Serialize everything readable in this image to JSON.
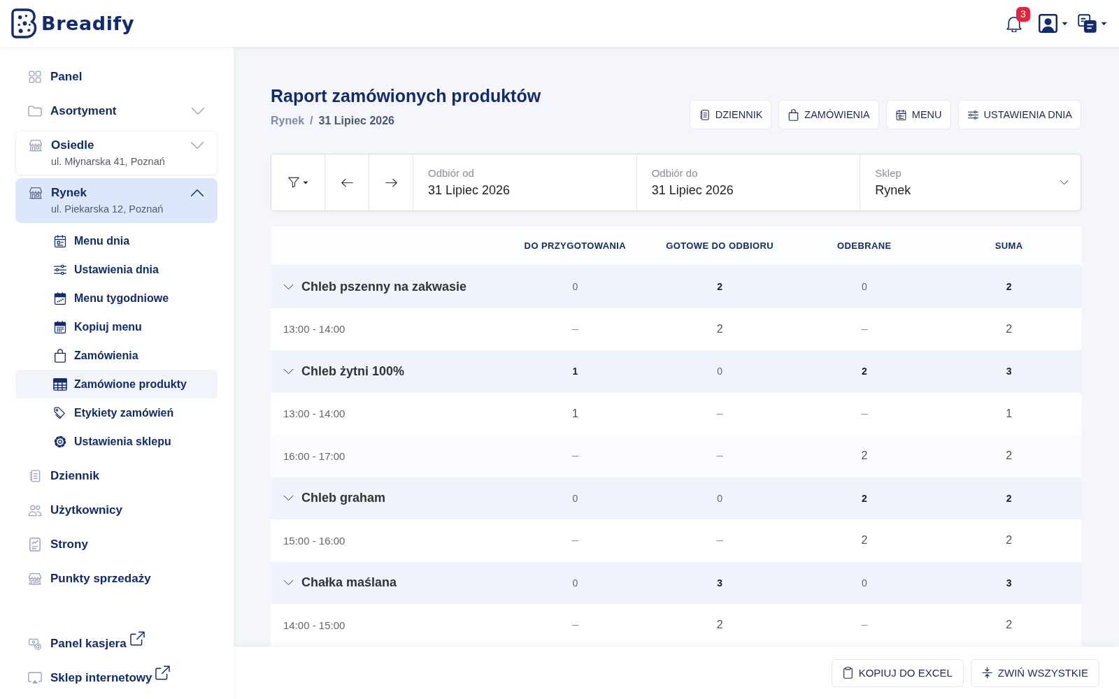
{
  "header": {
    "logo_text": "Breadify",
    "notifications": {
      "count": "3"
    }
  },
  "sidebar": {
    "items": [
      {
        "kind": "link",
        "label": "Panel",
        "selected": false
      },
      {
        "kind": "group",
        "label": "Asortyment",
        "expanded": false,
        "selected": false
      },
      {
        "kind": "store",
        "label": "Osiedle",
        "address": "ul. Młynarska 41, Poznań",
        "expanded": false,
        "selected": false
      },
      {
        "kind": "store",
        "label": "Rynek",
        "address": "ul. Piekarska 12, Poznań",
        "expanded": true,
        "selected": true,
        "children": [
          {
            "label": "Menu dnia",
            "selected": false
          },
          {
            "label": "Ustawienia dnia",
            "selected": false
          },
          {
            "label": "Menu tygodniowe",
            "selected": false
          },
          {
            "label": "Kopiuj menu",
            "selected": false
          },
          {
            "label": "Zamówienia",
            "selected": false
          },
          {
            "label": "Zamówione produkty",
            "selected": true
          },
          {
            "label": "Etykiety zamówień",
            "selected": false
          },
          {
            "label": "Ustawienia sklepu",
            "selected": false
          }
        ]
      },
      {
        "kind": "link",
        "label": "Dziennik",
        "selected": false
      },
      {
        "kind": "link",
        "label": "Użytkownicy",
        "selected": false
      },
      {
        "kind": "link",
        "label": "Strony",
        "selected": false
      },
      {
        "kind": "link",
        "label": "Punkty sprzedaży",
        "selected": false
      }
    ],
    "external_links": [
      {
        "label": "Panel kasjera"
      },
      {
        "label": "Sklep internetowy"
      }
    ]
  },
  "page": {
    "title": "Raport zamówionych produktów",
    "breadcrumb": {
      "items": [
        "Rynek",
        "31 Lipiec 2026"
      ],
      "separator": "/"
    },
    "actions": [
      "DZIENNIK",
      "ZAMÓWIENIA",
      "MENU",
      "USTAWIENIA DNIA"
    ]
  },
  "filters": {
    "fields": [
      {
        "kind": "date",
        "label": "Odbiór od",
        "value": "31 Lipiec 2026"
      },
      {
        "kind": "date",
        "label": "Odbiór do",
        "value": "31 Lipiec 2026"
      },
      {
        "kind": "select",
        "label": "Sklep",
        "value": "Rynek"
      }
    ]
  },
  "table": {
    "columns": [
      "DO PRZYGOTOWANIA",
      "GOTOWE DO ODBIORU",
      "ODEBRANE",
      "SUMA"
    ],
    "groups": [
      {
        "name": "Chleb pszenny na zakwasie",
        "expanded": true,
        "cells": [
          {
            "value": "0",
            "bold": false
          },
          {
            "value": "2",
            "bold": true
          },
          {
            "value": "0",
            "bold": false
          },
          {
            "value": "2",
            "bold": true
          }
        ],
        "rows": [
          {
            "time": "13:00 - 14:00",
            "cells": [
              {
                "value": "–",
                "muted": true
              },
              {
                "value": "2",
                "muted": false
              },
              {
                "value": "–",
                "muted": true
              },
              {
                "value": "2",
                "muted": false
              }
            ]
          }
        ]
      },
      {
        "name": "Chleb żytni 100%",
        "expanded": true,
        "cells": [
          {
            "value": "1",
            "bold": true
          },
          {
            "value": "0",
            "bold": false
          },
          {
            "value": "2",
            "bold": true
          },
          {
            "value": "3",
            "bold": true
          }
        ],
        "rows": [
          {
            "time": "13:00 - 14:00",
            "cells": [
              {
                "value": "1",
                "muted": false
              },
              {
                "value": "–",
                "muted": true
              },
              {
                "value": "–",
                "muted": true
              },
              {
                "value": "1",
                "muted": false
              }
            ]
          },
          {
            "time": "16:00 - 17:00",
            "cells": [
              {
                "value": "–",
                "muted": true
              },
              {
                "value": "–",
                "muted": true
              },
              {
                "value": "2",
                "muted": false
              },
              {
                "value": "2",
                "muted": false
              }
            ]
          }
        ]
      },
      {
        "name": "Chleb graham",
        "expanded": true,
        "cells": [
          {
            "value": "0",
            "bold": false
          },
          {
            "value": "0",
            "bold": false
          },
          {
            "value": "2",
            "bold": true
          },
          {
            "value": "2",
            "bold": true
          }
        ],
        "rows": [
          {
            "time": "15:00 - 16:00",
            "cells": [
              {
                "value": "–",
                "muted": true
              },
              {
                "value": "–",
                "muted": true
              },
              {
                "value": "2",
                "muted": false
              },
              {
                "value": "2",
                "muted": false
              }
            ]
          }
        ]
      },
      {
        "name": "Chałka maślana",
        "expanded": true,
        "cells": [
          {
            "value": "0",
            "bold": false
          },
          {
            "value": "3",
            "bold": true
          },
          {
            "value": "0",
            "bold": false
          },
          {
            "value": "3",
            "bold": true
          }
        ],
        "rows": [
          {
            "time": "14:00 - 15:00",
            "cells": [
              {
                "value": "–",
                "muted": true
              },
              {
                "value": "2",
                "muted": false
              },
              {
                "value": "–",
                "muted": true
              },
              {
                "value": "2",
                "muted": false
              }
            ]
          }
        ]
      }
    ]
  },
  "footer": {
    "buttons": [
      "KOPIUJ DO EXCEL",
      "ZWIŃ WSZYSTKIE"
    ]
  }
}
